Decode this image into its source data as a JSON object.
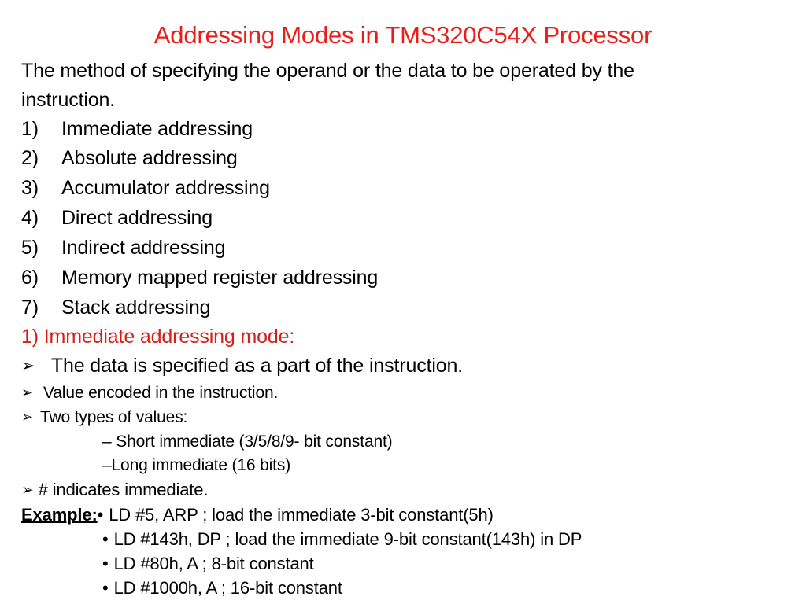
{
  "colors": {
    "title_red": "#EC1C18",
    "heading_red": "#D52019",
    "body_black": "#000000",
    "background": "#FFFFFF"
  },
  "slide": {
    "title": "Addressing Modes in TMS320C54X Processor",
    "intro": {
      "line1": "The method of specifying the operand or the data to be operated by the",
      "line2": "instruction."
    },
    "numbered_list": [
      {
        "num": "1)",
        "label": "Immediate addressing"
      },
      {
        "num": "2)",
        "label": "Absolute addressing"
      },
      {
        "num": "3)",
        "label": "Accumulator addressing"
      },
      {
        "num": "4)",
        "label": "Direct addressing"
      },
      {
        "num": "5)",
        "label": "Indirect addressing"
      },
      {
        "num": "6)",
        "label": "Memory mapped register addressing"
      },
      {
        "num": "7)",
        "label": "Stack addressing"
      }
    ],
    "subheading": "1) Immediate addressing mode:",
    "arrow_bullet_glyph": "➢",
    "bullets": [
      {
        "text": "The data is specified as a part of the instruction."
      },
      {
        "text": "Value encoded in the instruction."
      },
      {
        "text": "Two types of values:"
      },
      {
        "text": "# indicates immediate."
      }
    ],
    "sub_items": [
      "– Short immediate (3/5/8/9- bit constant)",
      "–Long immediate (16 bits)"
    ],
    "example": {
      "label": "Example:",
      "dot_glyph": "•",
      "first_line": "LD #5, ARP ; load the immediate 3-bit constant(5h)",
      "lines": [
        "LD #143h, DP ; load the immediate 9-bit constant(143h) in DP",
        "LD #80h, A ; 8-bit constant",
        "LD #1000h, A ; 16-bit constant"
      ]
    }
  }
}
